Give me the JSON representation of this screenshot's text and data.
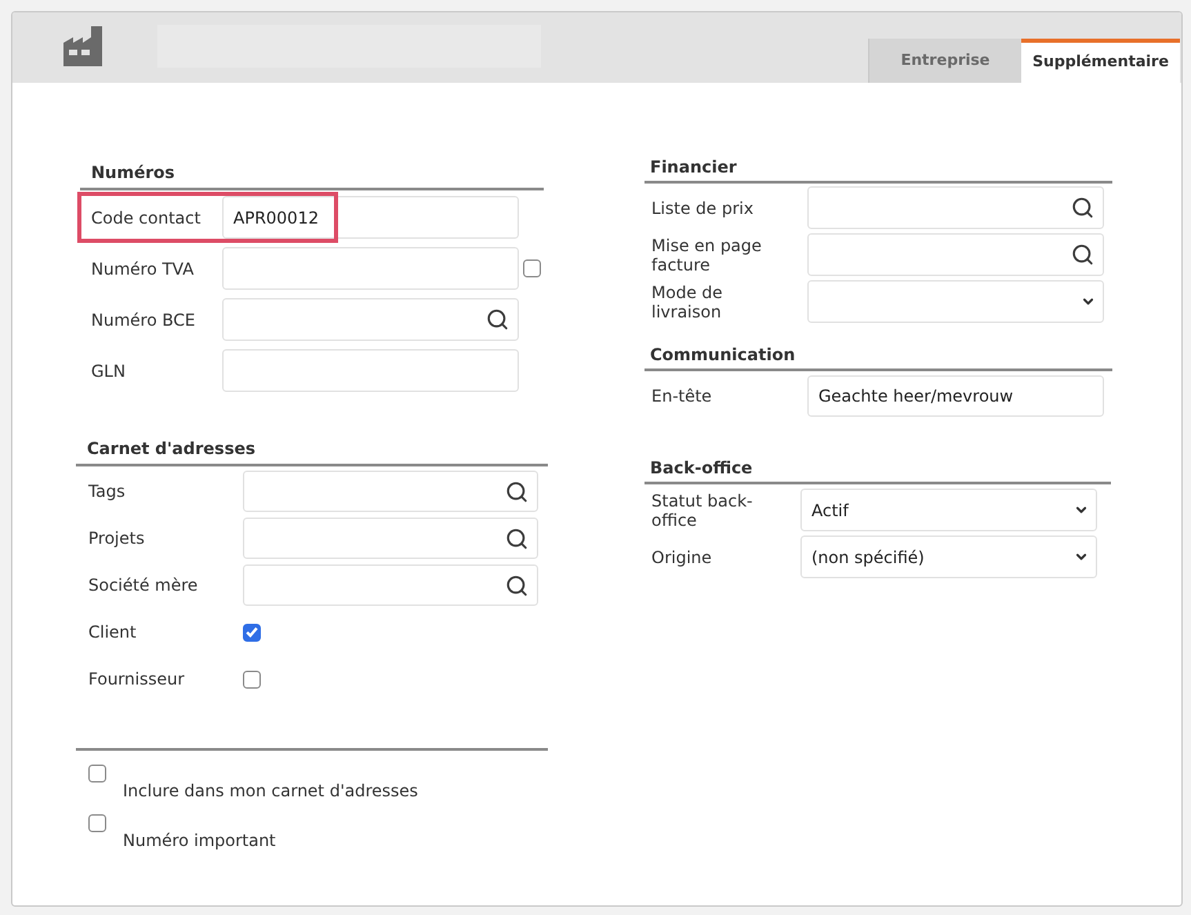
{
  "header": {
    "tabs": [
      {
        "label": "Entreprise",
        "selected": false
      },
      {
        "label": "Supplémentaire",
        "selected": true
      }
    ]
  },
  "columns": [
    {
      "sections": [
        {
          "title": "Numéros",
          "rows": [
            {
              "kind": "input",
              "label": "Code contact",
              "value": "APR00012",
              "highlighted": true
            },
            {
              "kind": "input",
              "label": "Numéro TVA",
              "checkbox": {
                "checked": false
              }
            },
            {
              "kind": "lookup",
              "label": "Numéro BCE"
            },
            {
              "kind": "input",
              "label": "GLN"
            }
          ]
        },
        {
          "title": "Carnet d'adresses",
          "rows": [
            {
              "kind": "lookup",
              "label": "Tags"
            },
            {
              "kind": "lookup",
              "label": "Projets"
            },
            {
              "kind": "lookup",
              "label": "Société mère"
            },
            {
              "kind": "checkbox",
              "label": "Client",
              "checked": true
            },
            {
              "kind": "checkbox",
              "label": "Fournisseur",
              "checked": false
            }
          ]
        }
      ],
      "options": [
        {
          "label": "Inclure dans mon carnet d'adresses",
          "checked": false
        },
        {
          "label": "Numéro important",
          "checked": false
        }
      ]
    },
    {
      "sections": [
        {
          "title": "Financier",
          "rows": [
            {
              "kind": "lookup",
              "label": "Liste de prix"
            },
            {
              "kind": "lookup",
              "label": "Mise en page facture"
            },
            {
              "kind": "select",
              "label": "Mode de livraison"
            }
          ]
        },
        {
          "title": "Communication",
          "rows": [
            {
              "kind": "input",
              "label": "En-tête",
              "value": "Geachte heer/mevrouw"
            }
          ]
        },
        {
          "title": "Back-office",
          "rows": [
            {
              "kind": "select",
              "label": "Statut back-office",
              "value": "Actif"
            },
            {
              "kind": "select",
              "label": "Origine",
              "value": "(non spécifié)"
            }
          ]
        }
      ]
    }
  ]
}
